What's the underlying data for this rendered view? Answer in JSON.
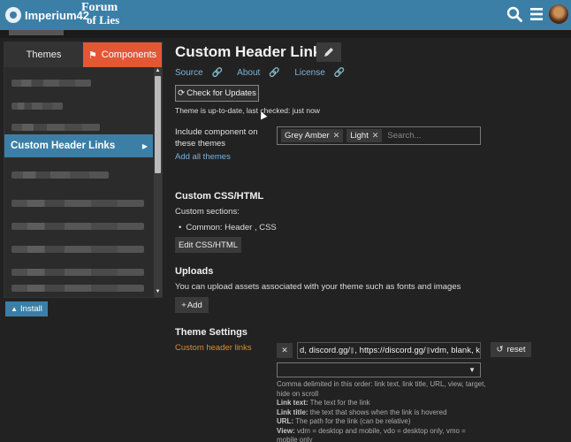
{
  "header": {
    "logo_primary": "Imperium42",
    "logo_secondary_top": "Forum",
    "logo_secondary_bottom": "of Lies",
    "search_icon": "search-icon",
    "menu_icon": "hamburger-menu-icon",
    "avatar_icon": "user-avatar"
  },
  "sidebar": {
    "tabs": [
      {
        "label": "Themes"
      },
      {
        "label": "Components"
      }
    ],
    "active_item": "Custom Header Links",
    "install_label": "Install"
  },
  "main": {
    "title": "Custom Header Links",
    "links": {
      "source": "Source",
      "about": "About",
      "license": "License"
    },
    "check_updates": "Check for Updates",
    "update_status": "Theme is up-to-date, last checked: just now",
    "include_label": "Include component on these themes",
    "chips": [
      "Grey Amber",
      "Light"
    ],
    "chips_placeholder": "Search...",
    "add_all": "Add all themes",
    "custom_css": {
      "heading": "Custom CSS/HTML",
      "sections_label": "Custom sections:",
      "bullet": "Common: Header , CSS",
      "button": "Edit CSS/HTML"
    },
    "uploads": {
      "heading": "Uploads",
      "text": "You can upload assets associated with your theme such as fonts and images",
      "button": "Add"
    },
    "theme_settings": {
      "heading": "Theme Settings",
      "setting_label": "Custom header links",
      "value_part1": "d, discord.gg/",
      "value_part2": ", https://discord.gg/",
      "value_part3": " vdm, blank, k",
      "reset": "reset",
      "help_line": "Comma delimited in this order: link text, link title, URL, view, target, hide on scroll",
      "help_link_text_label": "Link text:",
      "help_link_text": "The text for the link",
      "help_link_title_label": "Link title:",
      "help_link_title": "the text that shows when the link is hovered",
      "help_url_label": "URL:",
      "help_url": "The path for the link (can be relative)",
      "help_view_label": "View:",
      "help_view": "vdm = desktop and mobile, vdo = desktop only, vmo = mobile only"
    }
  },
  "colors": {
    "header_bg": "#3b7fa7",
    "accent_orange": "#e45735",
    "link_blue": "#7bb3dd",
    "setting_label": "#d88b3b",
    "page_bg": "#222222"
  }
}
